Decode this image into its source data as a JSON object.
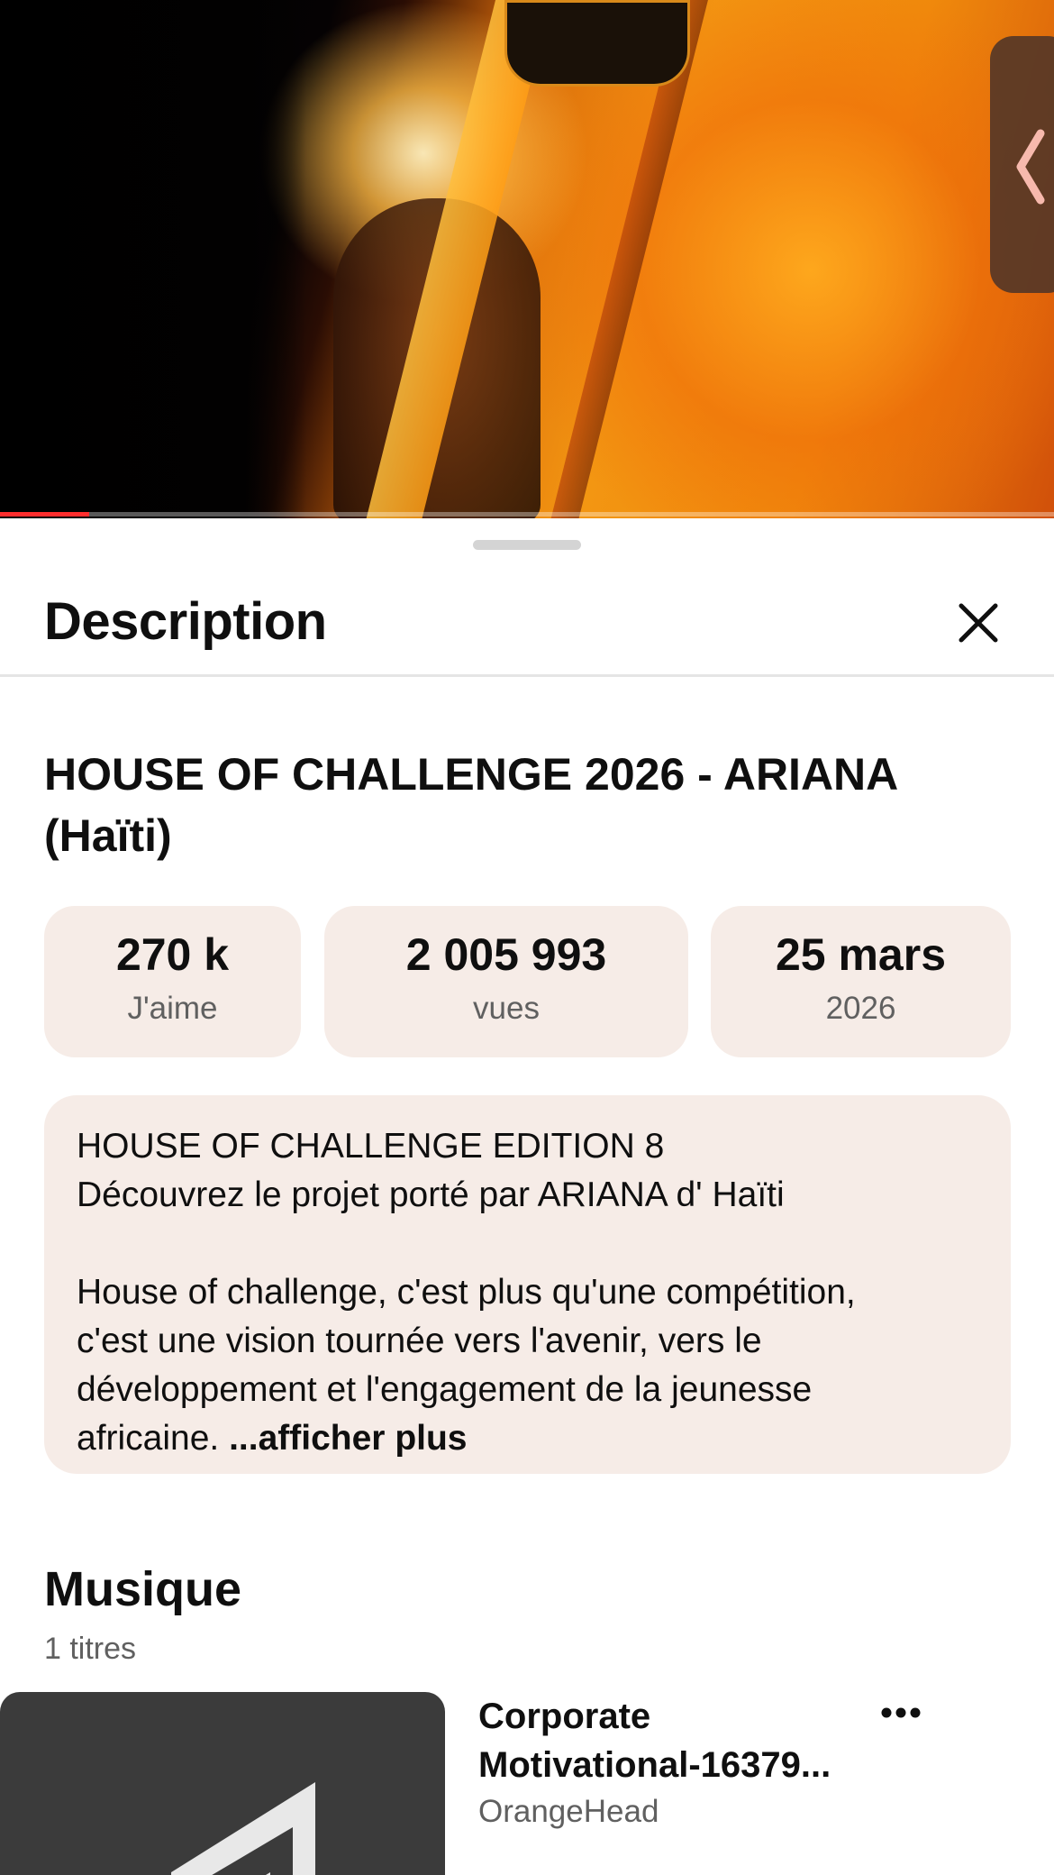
{
  "video": {
    "progress_percent": 8.5
  },
  "sheet": {
    "title": "Description",
    "video_title": "HOUSE OF CHALLENGE 2026 - ARIANA (Haïti)",
    "stats": {
      "likes_value": "270 k",
      "likes_label": "J'aime",
      "views_value": "2 005 993",
      "views_label": "vues",
      "date_value": "25 mars",
      "date_label": "2026"
    },
    "description": {
      "line1": "HOUSE OF CHALLENGE EDITION 8",
      "line2": "Découvrez le projet porté par ARIANA d' Haïti",
      "line3": "House of challenge, c'est plus qu'une compétition,",
      "line4": "c'est une vision tournée vers l'avenir, vers le",
      "line5": "développement et l'engagement de la jeunesse",
      "line6": "africaine. ",
      "more_label": "...afficher plus"
    },
    "music": {
      "title": "Musique",
      "count": "1 titres",
      "track": {
        "name_line1": "Corporate",
        "name_line2": "Motivational-16379...",
        "artist": "OrangeHead"
      }
    }
  },
  "icons": {
    "close": "close-icon",
    "more": "more-horizontal-icon",
    "side_panel": "chevron-left-icon"
  },
  "colors": {
    "card_bg": "#f6ece7",
    "secondary_text": "#606060",
    "progress": "#ff2d2d"
  }
}
